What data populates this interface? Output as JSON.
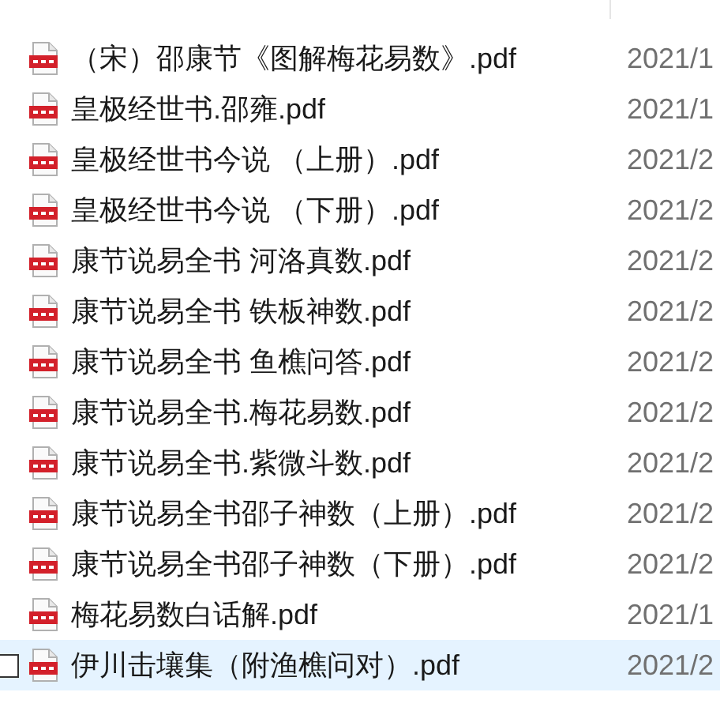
{
  "files": [
    {
      "name": "（宋）邵康节《图解梅花易数》.pdf",
      "date": "2021/1",
      "hovered": false
    },
    {
      "name": "皇极经世书.邵雍.pdf",
      "date": "2021/1",
      "hovered": false
    },
    {
      "name": "皇极经世书今说 （上册）.pdf",
      "date": "2021/2",
      "hovered": false
    },
    {
      "name": "皇极经世书今说 （下册）.pdf",
      "date": "2021/2",
      "hovered": false
    },
    {
      "name": "康节说易全书 河洛真数.pdf",
      "date": "2021/2",
      "hovered": false
    },
    {
      "name": "康节说易全书 铁板神数.pdf",
      "date": "2021/2",
      "hovered": false
    },
    {
      "name": "康节说易全书 鱼樵问答.pdf",
      "date": "2021/2",
      "hovered": false
    },
    {
      "name": "康节说易全书.梅花易数.pdf",
      "date": "2021/2",
      "hovered": false
    },
    {
      "name": "康节说易全书.紫微斗数.pdf",
      "date": "2021/2",
      "hovered": false
    },
    {
      "name": "康节说易全书邵子神数（上册）.pdf",
      "date": "2021/2",
      "hovered": false
    },
    {
      "name": "康节说易全书邵子神数（下册）.pdf",
      "date": "2021/2",
      "hovered": false
    },
    {
      "name": "梅花易数白话解.pdf",
      "date": "2021/1",
      "hovered": false
    },
    {
      "name": "伊川击壤集（附渔樵问对）.pdf",
      "date": "2021/2",
      "hovered": true,
      "checked": false
    }
  ]
}
